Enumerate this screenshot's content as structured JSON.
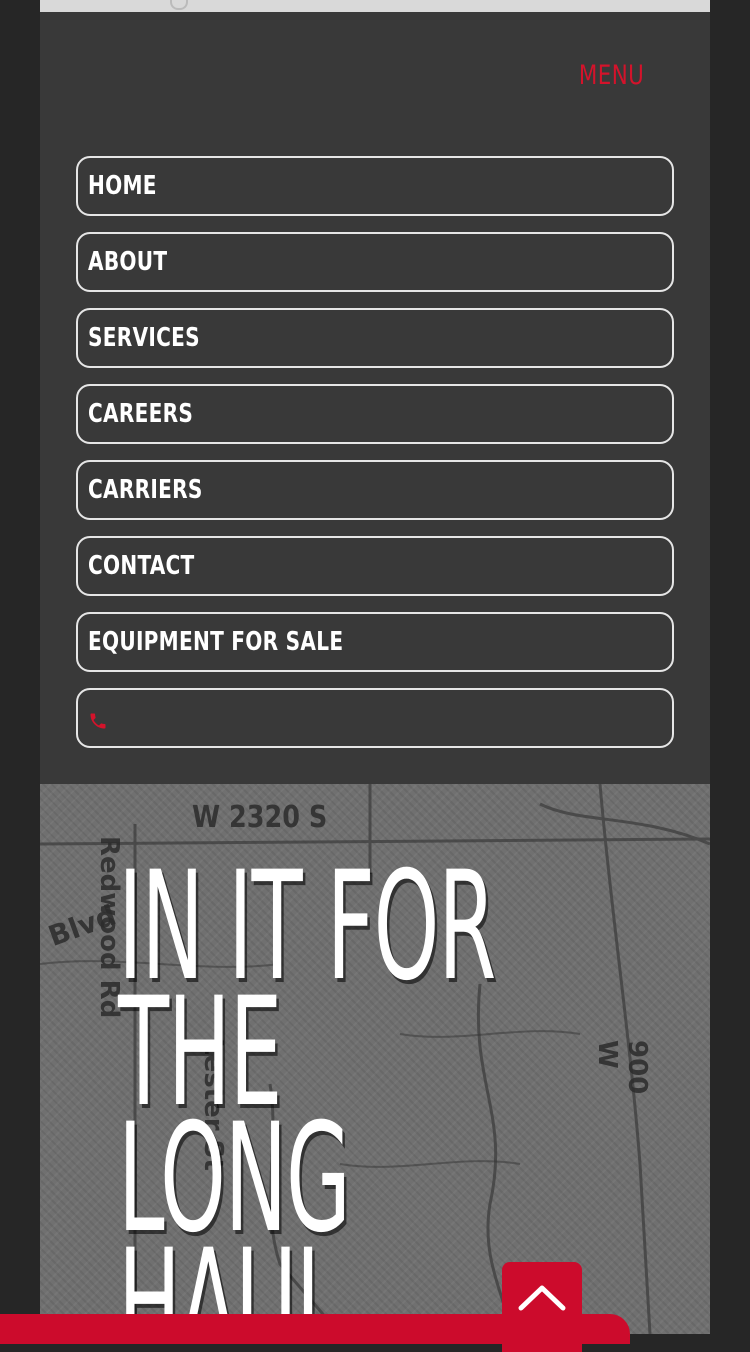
{
  "header": {
    "menu_label": "MENU"
  },
  "nav": {
    "items": [
      {
        "label": "HOME"
      },
      {
        "label": "ABOUT"
      },
      {
        "label": "SERVICES"
      },
      {
        "label": "CAREERS"
      },
      {
        "label": "CARRIERS"
      },
      {
        "label": "CONTACT"
      },
      {
        "label": "EQUIPMENT FOR SALE"
      }
    ],
    "phone_icon": "phone-icon"
  },
  "hero": {
    "title_lines": [
      "IN IT FOR",
      "THE",
      "LONG",
      "HAUL"
    ],
    "map_labels": [
      "W 2320 S",
      "Redwood Rd",
      "Blvd",
      "Lester St",
      "900 W"
    ]
  },
  "controls": {
    "back_to_top_icon": "chevron-up-icon"
  },
  "colors": {
    "accent": "#cc0b2c",
    "panel": "#393939",
    "background": "#262626"
  }
}
